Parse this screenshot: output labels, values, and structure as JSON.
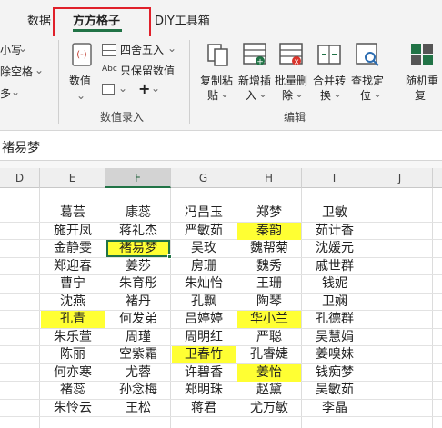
{
  "tabs": [
    {
      "label": "数据",
      "active": false
    },
    {
      "label": "方方格子",
      "active": true
    },
    {
      "label": "DIY工具箱",
      "active": false
    }
  ],
  "ribbon": {
    "left_partial": [
      "小写",
      "除空格",
      "多"
    ],
    "value_group": {
      "big_button": "数值",
      "round_label": "四舍五入",
      "keep_value_label": "只保留数值",
      "group_label": "数值录入"
    },
    "edit_group": {
      "buttons": [
        {
          "line1": "复制粘",
          "line2": "贴"
        },
        {
          "line1": "新增插",
          "line2": "入"
        },
        {
          "line1": "批量删",
          "line2": "除"
        },
        {
          "line1": "合并转",
          "line2": "换"
        },
        {
          "line1": "查找定",
          "line2": "位"
        }
      ],
      "group_label": "编辑"
    },
    "right_partial": {
      "line1": "随机重",
      "line2": "复"
    }
  },
  "formula_bar": {
    "content": "褚易梦"
  },
  "columns": [
    "D",
    "E",
    "F",
    "G",
    "H",
    "I",
    "J"
  ],
  "selected_column": "F",
  "accent_color": "#217346",
  "highlight_color": "#ffff33",
  "sheet": {
    "rows": [
      [
        "",
        "葛芸",
        "康蕊",
        "冯昌玉",
        "郑梦",
        "卫敏",
        ""
      ],
      [
        "",
        "施开凤",
        "蒋礼杰",
        "严敏茹",
        "秦韵",
        "茹计香",
        ""
      ],
      [
        "",
        "金静雯",
        "褚易梦",
        "吴玫",
        "魏帮菊",
        "沈媛元",
        ""
      ],
      [
        "",
        "郑迎春",
        "姜莎",
        "房珊",
        "魏秀",
        "戚世群",
        ""
      ],
      [
        "",
        "曹宁",
        "朱育彤",
        "朱灿怡",
        "王珊",
        "钱妮",
        ""
      ],
      [
        "",
        "沈燕",
        "褚丹",
        "孔飘",
        "陶琴",
        "卫娴",
        ""
      ],
      [
        "",
        "孔青",
        "何发弟",
        "吕婷婷",
        "华小兰",
        "孔德群",
        ""
      ],
      [
        "",
        "朱乐萱",
        "周瑾",
        "周明红",
        "严聪",
        "吴慧娟",
        ""
      ],
      [
        "",
        "陈丽",
        "空紫霜",
        "卫春竹",
        "孔睿婕",
        "姜嗅妹",
        ""
      ],
      [
        "",
        "何亦寒",
        "尤蓉",
        "许碧香",
        "姜怡",
        "钱痴梦",
        ""
      ],
      [
        "",
        "褚蕊",
        "孙念梅",
        "郑明珠",
        "赵黛",
        "吴敏茹",
        ""
      ],
      [
        "",
        "朱怜云",
        "王松",
        "蒋君",
        "尤万敏",
        "李晶",
        ""
      ]
    ],
    "highlighted": [
      [
        1,
        4
      ],
      [
        2,
        2
      ],
      [
        6,
        1
      ],
      [
        6,
        4
      ],
      [
        8,
        3
      ],
      [
        9,
        4
      ]
    ],
    "active_cell": [
      2,
      2
    ]
  }
}
